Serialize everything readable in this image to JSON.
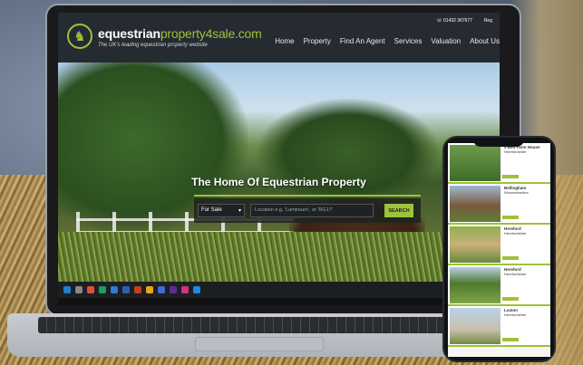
{
  "site": {
    "logo_main": "equestrian",
    "logo_accent": "property4sale.com",
    "tagline": "The UK's leading equestrian property website",
    "phone": "☏ 01432 367677",
    "register": "Reg"
  },
  "nav": {
    "items": [
      "Home",
      "Property",
      "Find An Agent",
      "Services",
      "Valuation",
      "About Us"
    ]
  },
  "hero": {
    "title": "The Home Of Equestrian Property",
    "select_value": "For Sale",
    "location_placeholder": "Location e.g. 'Lambourn', or 'RG17'",
    "search_label": "SEARCH"
  },
  "phone_listings": [
    {
      "title": "5 Bed Farm House",
      "sub": "Herefordshire"
    },
    {
      "title": "Bellingham",
      "sub": "Worcestershire"
    },
    {
      "title": "Hereford",
      "sub": "Herefordshire"
    },
    {
      "title": "Hereford",
      "sub": "Herefordshire"
    },
    {
      "title": "Luston",
      "sub": "Herefordshire"
    }
  ],
  "colors": {
    "accent": "#9dc23b",
    "header": "#252b30"
  }
}
